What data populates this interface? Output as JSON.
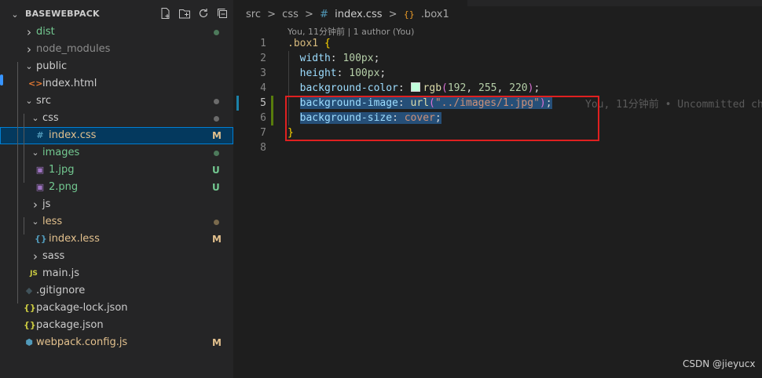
{
  "explorer": {
    "title": "BASEWEBPACK",
    "toolbar": [
      "new-file-icon",
      "new-folder-icon",
      "refresh-icon",
      "collapse-all-icon"
    ],
    "items": [
      {
        "name": "dist",
        "kind": "folder",
        "expanded": false,
        "depth": 1,
        "color": "#73c991",
        "indicator": "dot"
      },
      {
        "name": "node_modules",
        "kind": "folder",
        "expanded": false,
        "depth": 1,
        "color": "#8c8c8c"
      },
      {
        "name": "public",
        "kind": "folder",
        "expanded": true,
        "depth": 1,
        "color": "#cccccc"
      },
      {
        "name": "index.html",
        "kind": "html",
        "depth": 2,
        "color": "#cccccc"
      },
      {
        "name": "src",
        "kind": "folder",
        "expanded": true,
        "depth": 1,
        "color": "#cccccc",
        "indicator": "dot"
      },
      {
        "name": "css",
        "kind": "folder",
        "expanded": true,
        "depth": 2,
        "color": "#cccccc",
        "indicator": "dot"
      },
      {
        "name": "index.css",
        "kind": "css",
        "depth": 3,
        "color": "#e2c08d",
        "status": "M",
        "selected": true
      },
      {
        "name": "images",
        "kind": "folder",
        "expanded": true,
        "depth": 2,
        "color": "#73c991",
        "indicator": "dot"
      },
      {
        "name": "1.jpg",
        "kind": "image",
        "depth": 3,
        "color": "#73c991",
        "status": "U"
      },
      {
        "name": "2.png",
        "kind": "image",
        "depth": 3,
        "color": "#73c991",
        "status": "U"
      },
      {
        "name": "js",
        "kind": "folder",
        "expanded": false,
        "depth": 2,
        "color": "#cccccc"
      },
      {
        "name": "less",
        "kind": "folder",
        "expanded": true,
        "depth": 2,
        "color": "#e2c08d",
        "indicator": "dot"
      },
      {
        "name": "index.less",
        "kind": "less",
        "depth": 3,
        "color": "#e2c08d",
        "status": "M"
      },
      {
        "name": "sass",
        "kind": "folder",
        "expanded": false,
        "depth": 2,
        "color": "#cccccc"
      },
      {
        "name": "main.js",
        "kind": "js",
        "depth": 2,
        "color": "#cccccc"
      },
      {
        "name": ".gitignore",
        "kind": "git",
        "depth": 1,
        "color": "#cccccc"
      },
      {
        "name": "package-lock.json",
        "kind": "json",
        "depth": 1,
        "color": "#cccccc"
      },
      {
        "name": "package.json",
        "kind": "json",
        "depth": 1,
        "color": "#cccccc"
      },
      {
        "name": "webpack.config.js",
        "kind": "webpack",
        "depth": 1,
        "color": "#e2c08d",
        "status": "M"
      }
    ]
  },
  "editor": {
    "breadcrumb": [
      "src",
      ">",
      "css",
      ">",
      "#",
      "index.css",
      ">",
      "{}",
      ".box1"
    ],
    "codelens": "You, 11分钟前 | 1 author (You)",
    "current_line": 5,
    "lines": [
      {
        "num": "1",
        "tokens": [
          {
            "t": ".box1",
            "c": "sel"
          },
          {
            "t": " "
          },
          {
            "t": "{",
            "c": "br"
          }
        ]
      },
      {
        "num": "2",
        "tokens": [
          {
            "t": "  "
          },
          {
            "t": "width",
            "c": "prop"
          },
          {
            "t": ": "
          },
          {
            "t": "100px",
            "c": "num"
          },
          {
            "t": ";"
          }
        ]
      },
      {
        "num": "3",
        "tokens": [
          {
            "t": "  "
          },
          {
            "t": "height",
            "c": "prop"
          },
          {
            "t": ": "
          },
          {
            "t": "100px",
            "c": "num"
          },
          {
            "t": ";"
          }
        ]
      },
      {
        "num": "4",
        "tokens": [
          {
            "t": "  "
          },
          {
            "t": "background-color",
            "c": "prop"
          },
          {
            "t": ": "
          },
          {
            "t": "",
            "c": "swatch",
            "color": "#c0ffdc"
          },
          {
            "t": "rgb",
            "c": "fn"
          },
          {
            "t": "(",
            "c": "pn"
          },
          {
            "t": "192",
            "c": "num"
          },
          {
            "t": ", "
          },
          {
            "t": "255",
            "c": "num"
          },
          {
            "t": ", "
          },
          {
            "t": "220",
            "c": "num"
          },
          {
            "t": ")",
            "c": "pn"
          },
          {
            "t": ";"
          }
        ]
      },
      {
        "num": "5",
        "tokens": [
          {
            "t": "  "
          },
          {
            "t": "background-image",
            "c": "prop",
            "s": true
          },
          {
            "t": ": ",
            "s": true
          },
          {
            "t": "url",
            "c": "fn",
            "s": true
          },
          {
            "t": "(",
            "c": "pn",
            "s": true
          },
          {
            "t": "\"../images/1.jpg\"",
            "c": "str",
            "s": true
          },
          {
            "t": ")",
            "c": "pn",
            "s": true
          },
          {
            "t": ";",
            "s": true
          }
        ]
      },
      {
        "num": "6",
        "tokens": [
          {
            "t": "  "
          },
          {
            "t": "background-size",
            "c": "prop",
            "s": true
          },
          {
            "t": ": ",
            "s": true
          },
          {
            "t": "cover",
            "c": "str",
            "s": true
          },
          {
            "t": ";",
            "s": true
          }
        ]
      },
      {
        "num": "7",
        "tokens": [
          {
            "t": "}",
            "c": "br"
          }
        ]
      },
      {
        "num": "8",
        "tokens": []
      }
    ],
    "blame": "You, 11分钟前 • Uncommitted ch"
  },
  "watermark": "CSDN @jieyucx",
  "colors": {
    "sidebar": "#252526",
    "editor": "#1e1e1e",
    "selection": "#264f78",
    "annotation_box": "#e02020",
    "added_gutter": "#587c0c",
    "modified_gutter": "#1b81a8"
  }
}
